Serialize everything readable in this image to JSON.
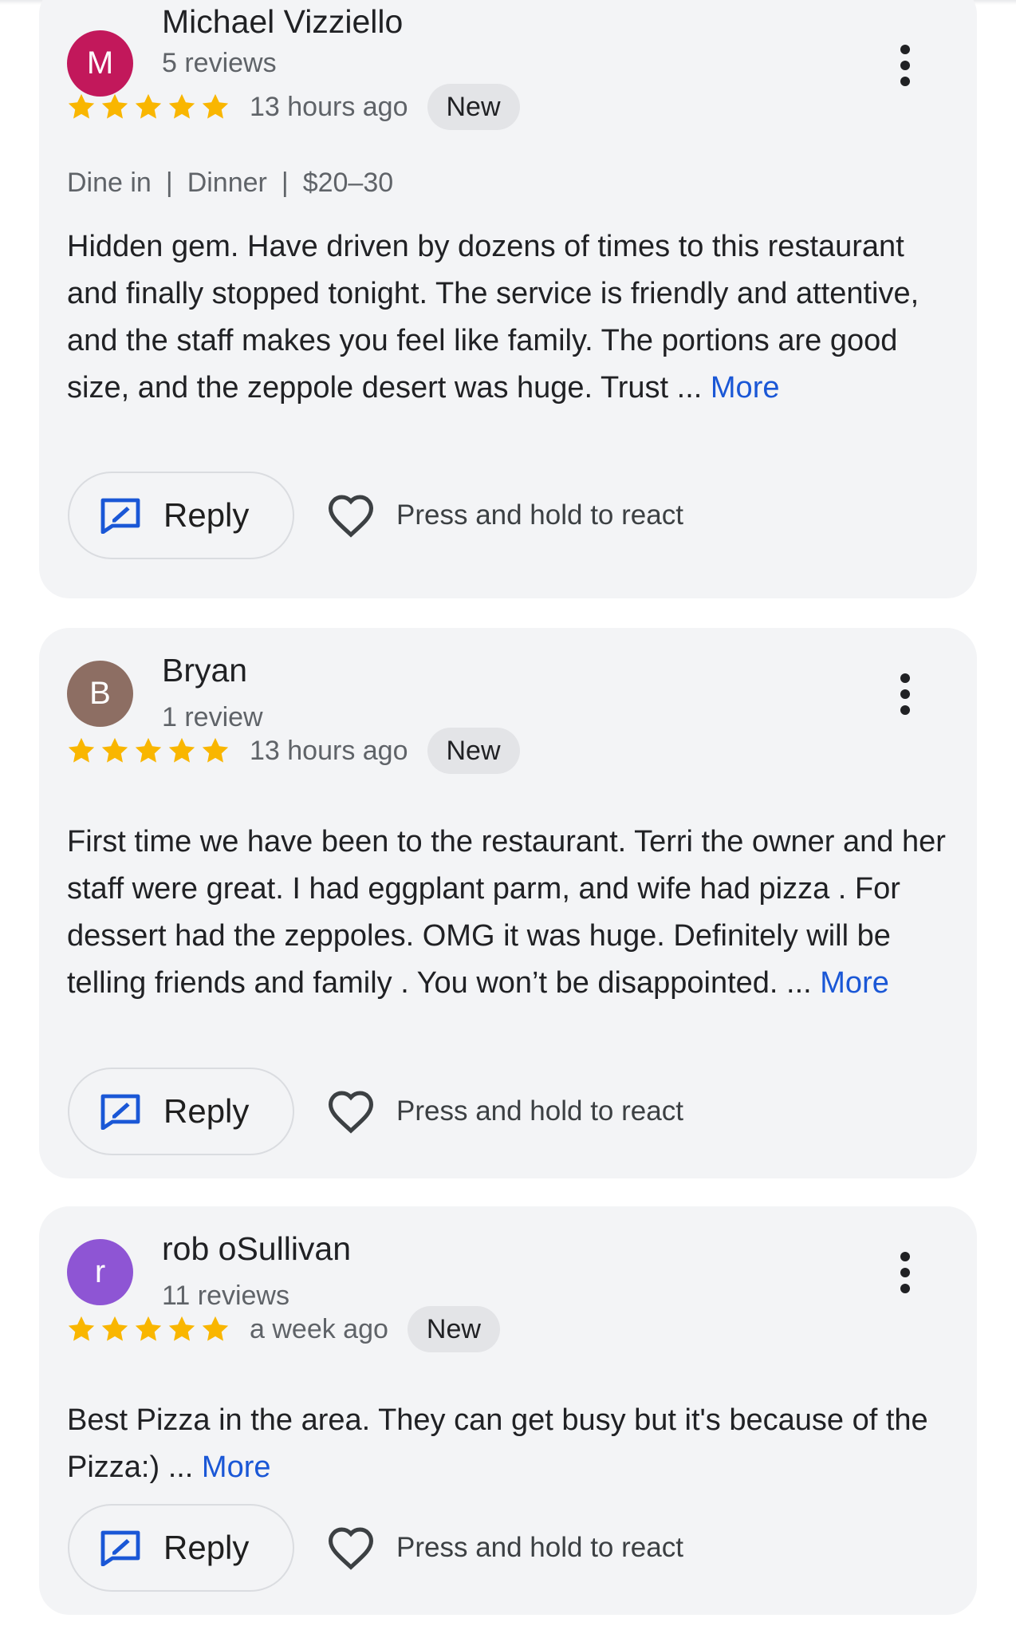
{
  "colors": {
    "star": "#f9b600",
    "link": "#1a57d6",
    "card_bg": "#f3f4f6"
  },
  "reviews": [
    {
      "avatar_letter": "M",
      "avatar_color": "#c2185b",
      "name": "Michael Vizziello",
      "review_count": "5 reviews",
      "rating": 5,
      "time_ago": "13 hours ago",
      "badge": "New",
      "meta": [
        "Dine in",
        "Dinner",
        "$20–30"
      ],
      "meta_separator": "|",
      "text": "Hidden gem. Have driven by dozens of times to this restaurant and finally stopped tonight. The service is friendly and attentive, and the staff makes you feel like family. The portions are good size, and the zeppole desert was huge. Trust ... ",
      "more_label": "More",
      "reply_label": "Reply",
      "react_label": "Press and hold to react"
    },
    {
      "avatar_letter": "B",
      "avatar_color": "#8d6e63",
      "name": "Bryan",
      "review_count": "1 review",
      "rating": 5,
      "time_ago": "13 hours ago",
      "badge": "New",
      "text": "First time we have been to the restaurant. Terri the owner and her staff were great. I had eggplant parm, and wife had pizza . For dessert had the zeppoles. OMG it was huge. Definitely will be telling friends and family . You won’t be disappointed. ... ",
      "more_label": "More",
      "reply_label": "Reply",
      "react_label": "Press and hold to react"
    },
    {
      "avatar_letter": "r",
      "avatar_color": "#8e55d4",
      "name": "rob oSullivan",
      "review_count": "11 reviews",
      "rating": 5,
      "time_ago": "a week ago",
      "badge": "New",
      "text": "Best Pizza in the area. They can get busy but it's because of the Pizza:) ... ",
      "more_label": "More",
      "reply_label": "Reply",
      "react_label": "Press and hold to react"
    }
  ]
}
